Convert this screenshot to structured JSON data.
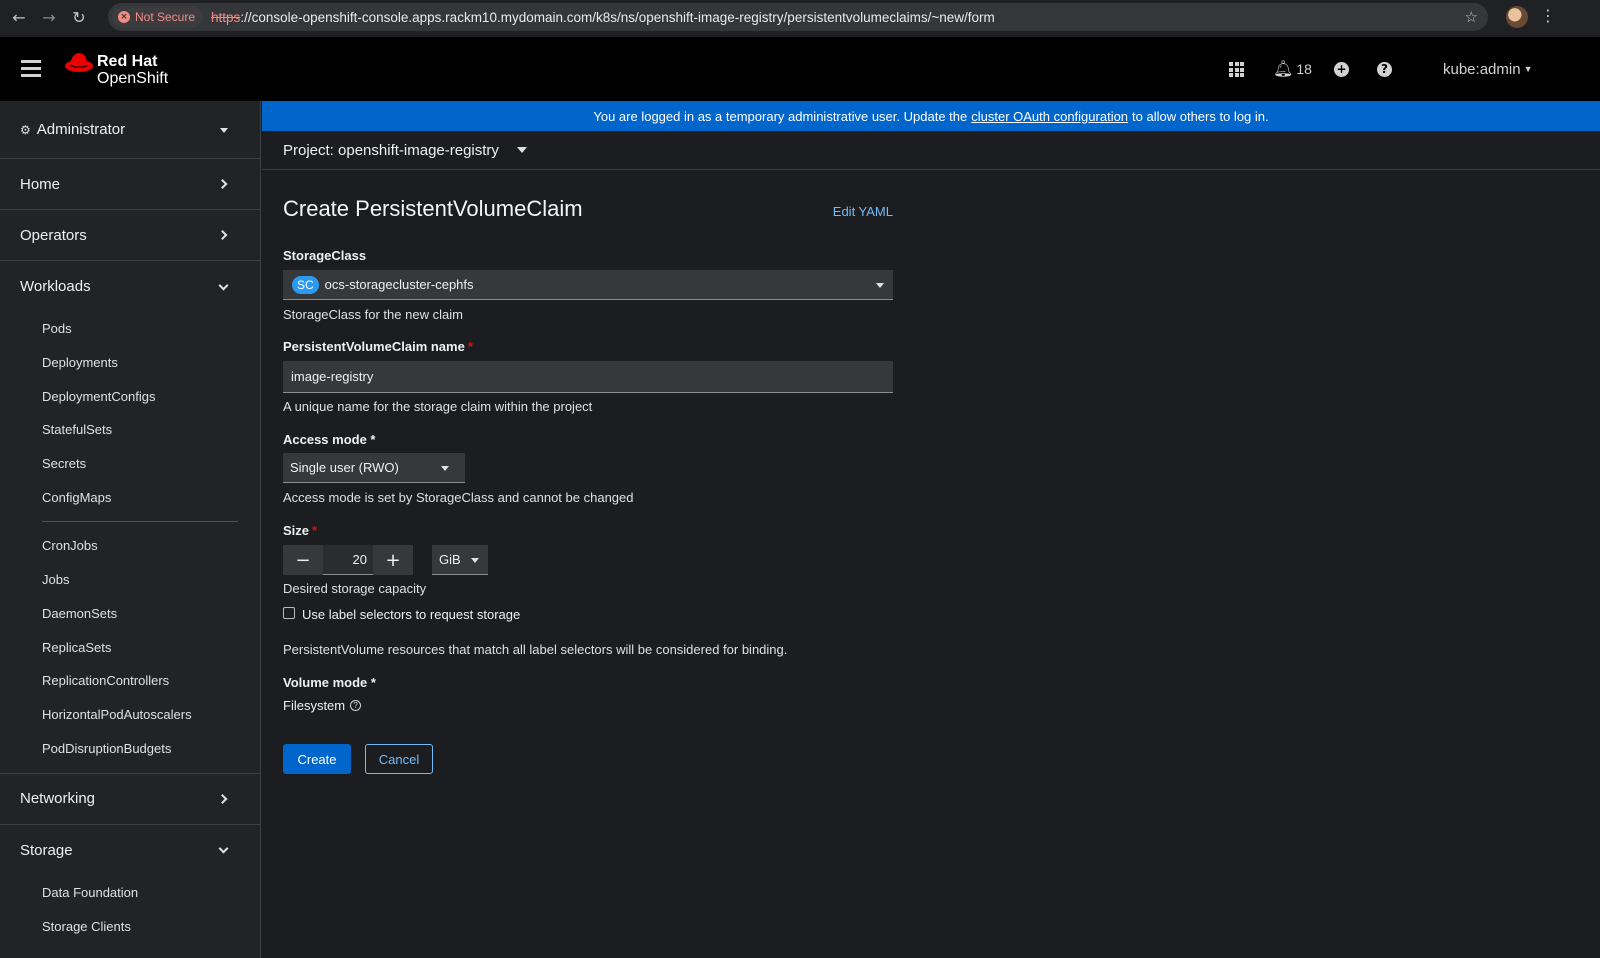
{
  "browser": {
    "security_label": "Not Secure",
    "url_scheme": "https",
    "url_rest": "://console-openshift-console.apps.rackm10.mydomain.com/k8s/ns/openshift-image-registry/persistentvolumeclaims/~new/form"
  },
  "masthead": {
    "brand_line1": "Red Hat",
    "brand_line2": "OpenShift",
    "notification_count": "18",
    "user": "kube:admin"
  },
  "sidebar": {
    "perspective": "Administrator",
    "sections": {
      "home": "Home",
      "operators": "Operators",
      "workloads": "Workloads",
      "networking": "Networking",
      "storage": "Storage"
    },
    "workloads_items": [
      "Pods",
      "Deployments",
      "DeploymentConfigs",
      "StatefulSets",
      "Secrets",
      "ConfigMaps"
    ],
    "workloads_items2": [
      "CronJobs",
      "Jobs",
      "DaemonSets",
      "ReplicaSets",
      "ReplicationControllers",
      "HorizontalPodAutoscalers",
      "PodDisruptionBudgets"
    ],
    "storage_items": [
      "Data Foundation",
      "Storage Clients"
    ]
  },
  "banner": {
    "text_before": "You are logged in as a temporary administrative user. Update the",
    "link": "cluster OAuth configuration",
    "text_after": "to allow others to log in."
  },
  "project": {
    "label": "Project: openshift-image-registry"
  },
  "form": {
    "title": "Create PersistentVolumeClaim",
    "edit_yaml": "Edit YAML",
    "storageclass_label": "StorageClass",
    "storageclass_badge": "SC",
    "storageclass_value": "ocs-storagecluster-cephfs",
    "storageclass_help": "StorageClass for the new claim",
    "name_label": "PersistentVolumeClaim name",
    "name_value": "image-registry",
    "name_help": "A unique name for the storage claim within the project",
    "access_label": "Access mode *",
    "access_value": "Single user (RWO)",
    "access_help": "Access mode is set by StorageClass and cannot be changed",
    "size_label": "Size",
    "size_value": "20",
    "size_unit": "GiB",
    "size_help": "Desired storage capacity",
    "checkbox_label": "Use label selectors to request storage",
    "selector_help": "PersistentVolume resources that match all label selectors will be considered for binding.",
    "volume_mode_label": "Volume mode *",
    "volume_mode_value": "Filesystem",
    "create_button": "Create",
    "cancel_button": "Cancel"
  }
}
